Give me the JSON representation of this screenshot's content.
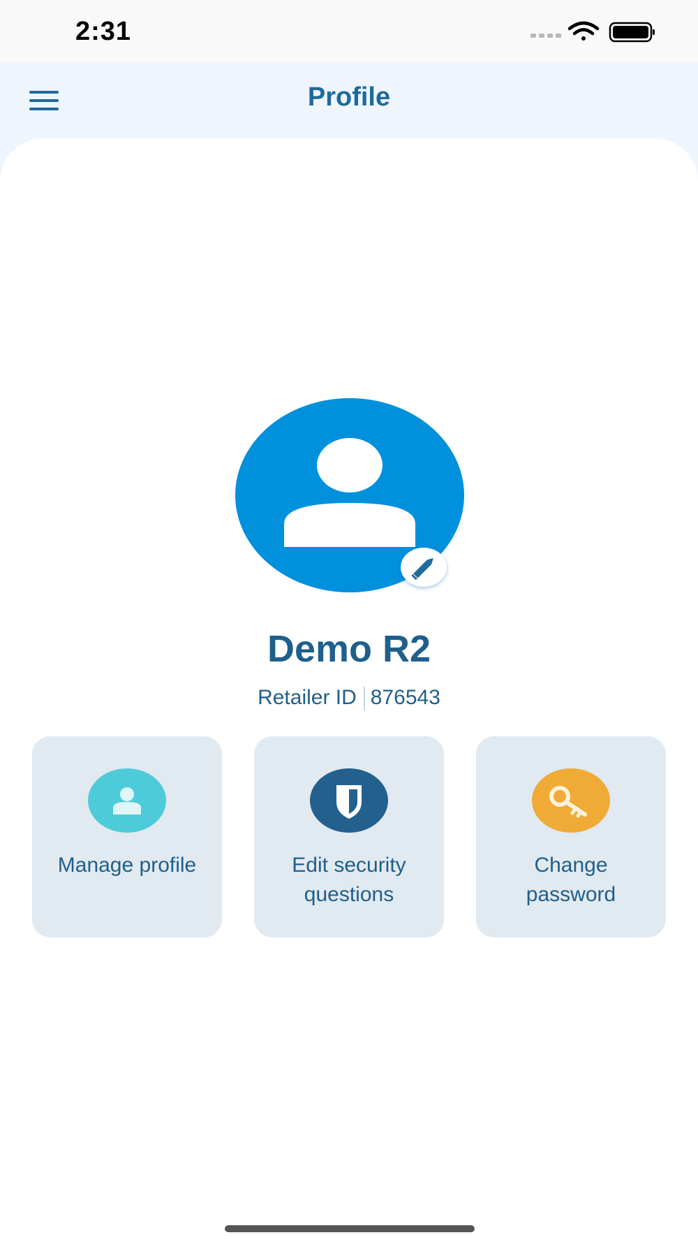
{
  "status_bar": {
    "time": "2:31",
    "icons": [
      "signal-icon",
      "wifi-icon",
      "battery-icon"
    ]
  },
  "header": {
    "title": "Profile",
    "menu_icon": "hamburger-menu-icon"
  },
  "profile": {
    "avatar_icon": "user-avatar-icon",
    "edit_icon": "pencil-icon",
    "name": "Demo R2",
    "retailer_id_label": "Retailer ID",
    "retailer_id_value": "876543"
  },
  "actions": [
    {
      "label": "Manage profile",
      "icon": "user-icon",
      "color": "#4ecbd9"
    },
    {
      "label": "Edit security questions",
      "icon": "shield-icon",
      "color": "#24608e"
    },
    {
      "label": "Change password",
      "icon": "key-icon",
      "color": "#efab35"
    }
  ],
  "colors": {
    "primary_text": "#1f5f8c",
    "avatar_blue": "#0090dc",
    "header_background": "#eef5fd",
    "tile_background": "#e1e9f1"
  }
}
